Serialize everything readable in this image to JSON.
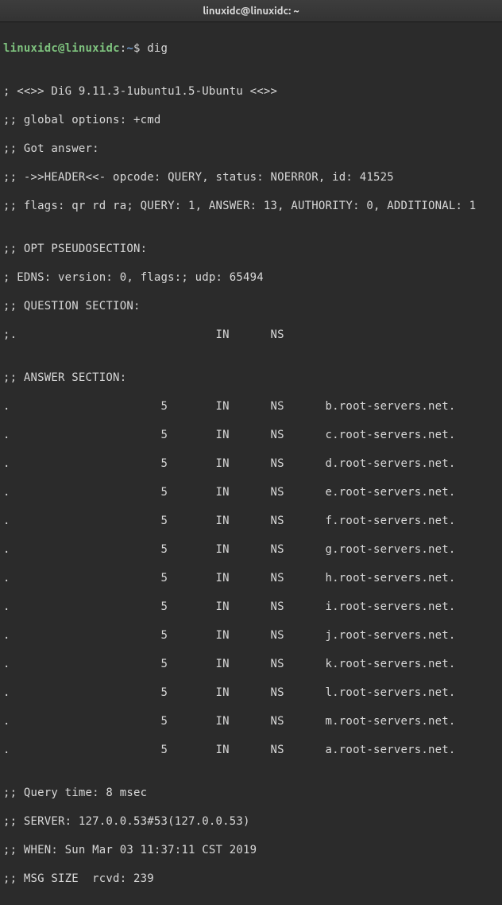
{
  "title": "linuxidc@linuxidc: ~",
  "prompt": {
    "user": "linuxidc",
    "at": "@",
    "host": "linuxidc",
    "colon": ":",
    "path": "~",
    "dollar": "$ "
  },
  "command": "dig",
  "blank": "",
  "output": {
    "l1": "; <<>> DiG 9.11.3-1ubuntu1.5-Ubuntu <<>>",
    "l2": ";; global options: +cmd",
    "l3": ";; Got answer:",
    "l4": ";; ->>HEADER<<- opcode: QUERY, status: NOERROR, id: 41525",
    "l5": ";; flags: qr rd ra; QUERY: 1, ANSWER: 13, AUTHORITY: 0, ADDITIONAL: 1",
    "l6": ";; OPT PSEUDOSECTION:",
    "l7": "; EDNS: version: 0, flags:; udp: 65494",
    "l8": ";; QUESTION SECTION:",
    "l9": ";.                             IN      NS",
    "l10": ";; ANSWER SECTION:",
    "a1": ".                      5       IN      NS      b.root-servers.net.",
    "a2": ".                      5       IN      NS      c.root-servers.net.",
    "a3": ".                      5       IN      NS      d.root-servers.net.",
    "a4": ".                      5       IN      NS      e.root-servers.net.",
    "a5": ".                      5       IN      NS      f.root-servers.net.",
    "a6": ".                      5       IN      NS      g.root-servers.net.",
    "a7": ".                      5       IN      NS      h.root-servers.net.",
    "a8": ".                      5       IN      NS      i.root-servers.net.",
    "a9": ".                      5       IN      NS      j.root-servers.net.",
    "a10": ".                      5       IN      NS      k.root-servers.net.",
    "a11": ".                      5       IN      NS      l.root-servers.net.",
    "a12": ".                      5       IN      NS      m.root-servers.net.",
    "a13": ".                      5       IN      NS      a.root-servers.net.",
    "f1": ";; Query time: 8 msec",
    "f2": ";; SERVER: 127.0.0.53#53(127.0.0.53)",
    "f3": ";; WHEN: Sun Mar 03 11:37:11 CST 2019",
    "f4": ";; MSG SIZE  rcvd: 239"
  }
}
